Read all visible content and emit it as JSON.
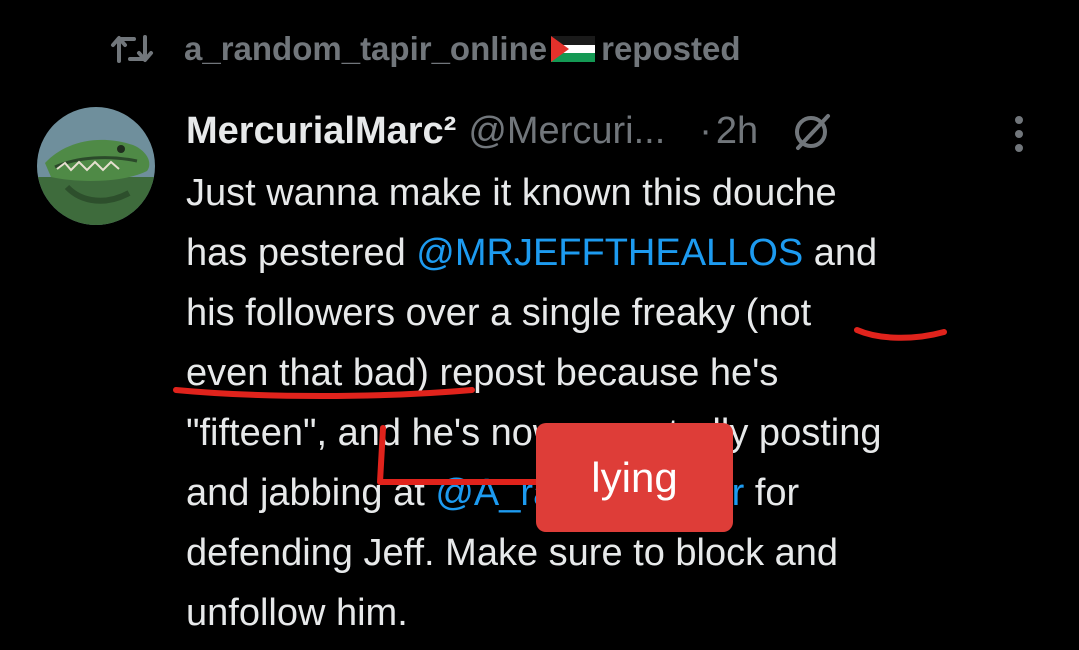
{
  "repost": {
    "icon": "repost-icon",
    "username": "a_random_tapir_online",
    "flag": "palestine-flag-icon",
    "label": "reposted"
  },
  "tweet": {
    "display_name": "MercurialMarc²",
    "handle": "@Mercuri...",
    "separator": "·",
    "time": "2h",
    "edit_icon": "no-edit-icon",
    "more_icon": "more-vertical-icon",
    "lines": [
      {
        "text": "Just wanna make it known this douche"
      },
      {
        "before": "has pestered ",
        "mention": "@MRJEFFTHEALLOS",
        "after": " and"
      },
      {
        "text": "his followers over a single freaky (not"
      },
      {
        "text": "even that bad) repost because he's"
      },
      {
        "text": "\"fifteen\", and he's now repeatedly posting"
      },
      {
        "before": "and jabbing at ",
        "mention": "@A_random_tapir",
        "after": " for"
      },
      {
        "text": "defending Jeff. Make sure to block and"
      },
      {
        "text": "unfollow him."
      }
    ]
  },
  "annotation": {
    "label": "lying",
    "box_color": "#de3d38",
    "stroke_color": "#e0231c"
  },
  "colors": {
    "background": "#000000",
    "text": "#e7e9ea",
    "muted": "#71767b",
    "link": "#1d9bf0"
  }
}
